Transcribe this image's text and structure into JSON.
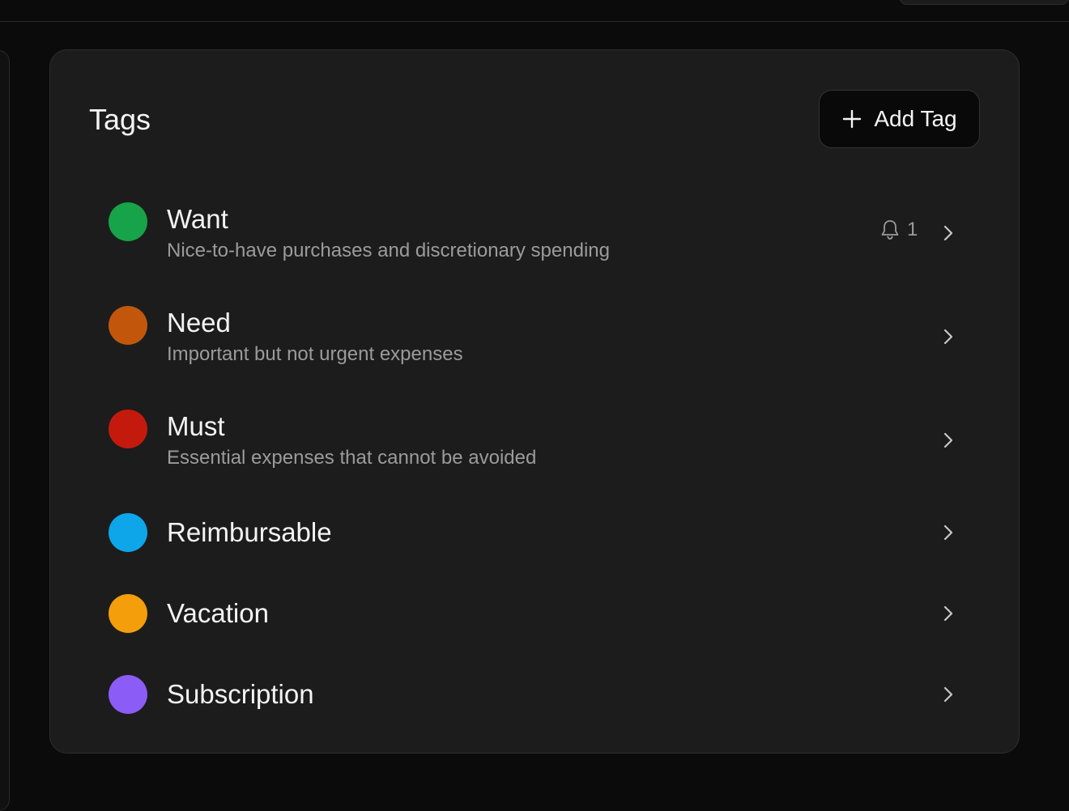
{
  "header": {
    "title": "Tags"
  },
  "toolbar": {
    "add_label": "Add Tag",
    "add_icon": "plus-icon"
  },
  "tags": [
    {
      "name": "Want",
      "description": "Nice-to-have purchases and discretionary spending",
      "color": "#16a34a",
      "alerts": "1"
    },
    {
      "name": "Need",
      "description": "Important but not urgent expenses",
      "color": "#c2570c"
    },
    {
      "name": "Must",
      "description": "Essential expenses that cannot be avoided",
      "color": "#c41a0e"
    },
    {
      "name": "Reimbursable",
      "color": "#0ea5e9"
    },
    {
      "name": "Vacation",
      "color": "#f59e0b"
    },
    {
      "name": "Subscription",
      "color": "#8b5cf6"
    }
  ],
  "icons": {
    "row_action": "chevron-right-icon",
    "alerts": "bell-icon"
  }
}
